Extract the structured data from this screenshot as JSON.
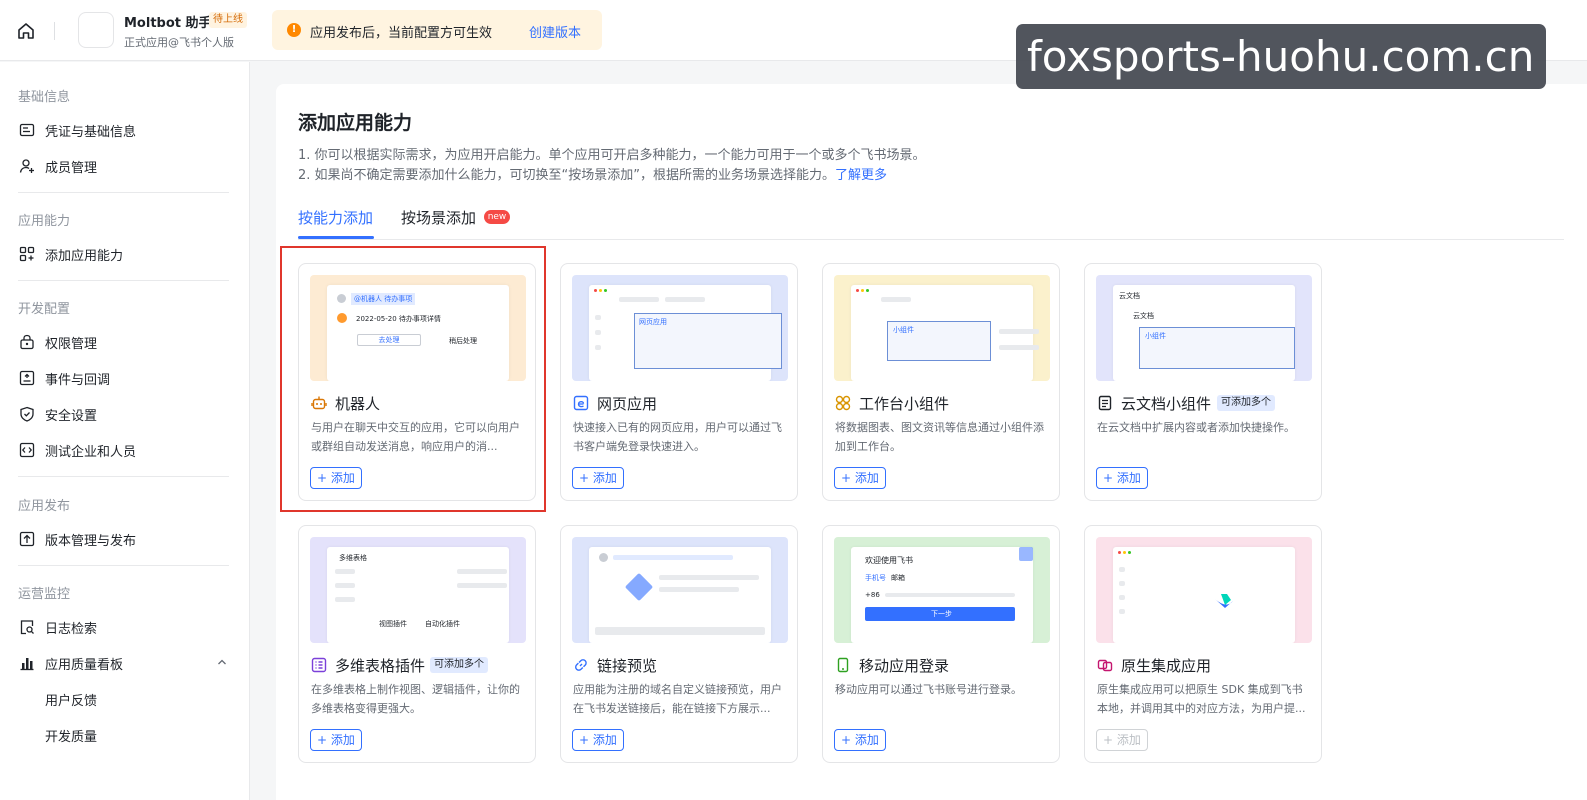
{
  "header": {
    "app_name": "Moltbot 助手",
    "app_status": "待上线",
    "app_subtitle": "正式应用@飞书个人版",
    "notice_text": "应用发布后，当前配置方可生效",
    "notice_link": "创建版本",
    "watermark": "foxsports-huohu.com.cn"
  },
  "sidebar": {
    "sections": [
      {
        "title": "基础信息",
        "items": [
          "凭证与基础信息",
          "成员管理"
        ]
      },
      {
        "title": "应用能力",
        "items": [
          "添加应用能力"
        ]
      },
      {
        "title": "开发配置",
        "items": [
          "权限管理",
          "事件与回调",
          "安全设置",
          "测试企业和人员"
        ]
      },
      {
        "title": "应用发布",
        "items": [
          "版本管理与发布"
        ]
      },
      {
        "title": "运营监控",
        "items": [
          "日志检索",
          "应用质量看板"
        ]
      }
    ],
    "sub_items": [
      "用户反馈",
      "开发质量"
    ]
  },
  "main": {
    "title": "添加应用能力",
    "desc1": "1. 你可以根据实际需求，为应用开启能力。单个应用可开启多种能力，一个能力可用于一个或多个飞书场景。",
    "desc2": "2. 如果尚不确定需要添加什么能力，可切换至“按场景添加”，根据所需的业务场景选择能力。",
    "learn_more": "了解更多",
    "tabs": [
      "按能力添加",
      "按场景添加"
    ],
    "new_badge": "new",
    "add_label": "+ 添加",
    "multi_label": "可添加多个",
    "cards": [
      {
        "title": "机器人",
        "desc": "与用户在聊天中交互的应用，它可以向用户或群组自动发送消息，响应用户的消...",
        "icon": "robot-icon"
      },
      {
        "title": "网页应用",
        "desc": "快速接入已有的网页应用，用户可以通过飞书客户端免登录快速进入。",
        "icon": "web-app-icon"
      },
      {
        "title": "工作台小组件",
        "desc": "将数据图表、图文资讯等信息通过小组件添加到工作台。",
        "icon": "widget-icon"
      },
      {
        "title": "云文档小组件",
        "desc": "在云文档中扩展内容或者添加快捷操作。",
        "icon": "doc-widget-icon"
      },
      {
        "title": "多维表格插件",
        "desc": "在多维表格上制作视图、逻辑插件，让你的多维表格变得更强大。",
        "icon": "bitable-icon"
      },
      {
        "title": "链接预览",
        "desc": "应用能为注册的域名自定义链接预览，用户在飞书发送链接后，能在链接下方展示...",
        "icon": "link-icon"
      },
      {
        "title": "移动应用登录",
        "desc": "移动应用可以通过飞书账号进行登录。",
        "icon": "mobile-icon"
      },
      {
        "title": "原生集成应用",
        "desc": "原生集成应用可以把原生 SDK 集成到飞书本地，并调用其中的对应方法，为用户提...",
        "icon": "native-icon"
      }
    ]
  },
  "previews": {
    "bot_tag": "@机器人 待办事项",
    "bot_date": "2022-05-20 待办事项详情",
    "bot_btn1": "去处理",
    "bot_btn2": "稍后处理",
    "web_label": "网页应用",
    "widget_label": "小组件",
    "doc_title": "云文档",
    "doc_sub": "云文档",
    "doc_widget": "小组件",
    "bitable_title": "多维表格",
    "bitable_a": "视图插件",
    "bitable_b": "自动化插件",
    "login_title": "欢迎使用飞书",
    "login_tab1": "手机号",
    "login_tab2": "邮箱",
    "login_cc": "+86",
    "login_btn": "下一步"
  },
  "colors": {
    "accent": "#3370ff",
    "highlight": "#e0362c",
    "warning": "#ff8800"
  }
}
